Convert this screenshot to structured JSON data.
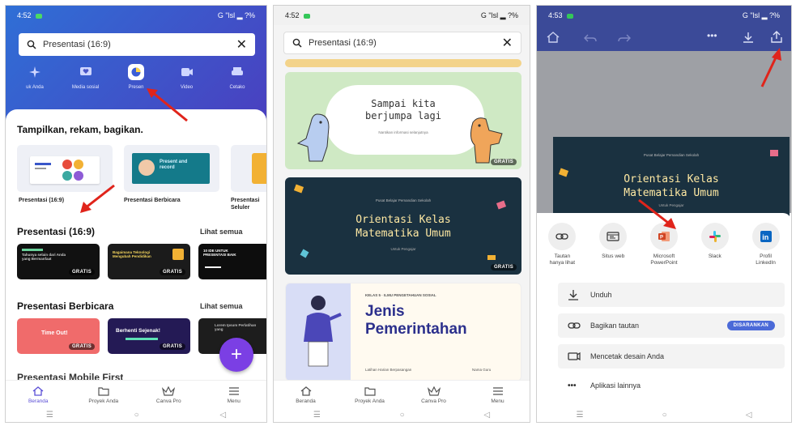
{
  "screen1": {
    "status_time": "4:52",
    "status_right": "G \"lsl ▂ ?% ",
    "search": {
      "query": "Presentasi (16:9)"
    },
    "categories": [
      {
        "label": "uk Anda",
        "icon": "sparkle-icon"
      },
      {
        "label": "Media sosial",
        "icon": "heart-icon"
      },
      {
        "label": "Presen",
        "icon": "presentation-icon"
      },
      {
        "label": "Video",
        "icon": "video-icon"
      },
      {
        "label": "Cetako",
        "icon": "print-icon"
      }
    ],
    "section_title": "Tampilkan, rekam, bagikan.",
    "tiles": [
      {
        "label": "Presentasi (16:9)"
      },
      {
        "label": "Presentasi Berbicara",
        "thumb_text": "Present and record"
      },
      {
        "label": "Presentasi Seluler"
      }
    ],
    "row1": {
      "title": "Presentasi (16:9)",
      "see_all": "Lihat semua",
      "items": [
        {
          "badge": "GRATIS",
          "text": "Tahunya selain dari Anda yang Bermanfaat"
        },
        {
          "badge": "GRATIS",
          "text": "Bagaimana Teknologi Mengubah Pendidikan"
        },
        {
          "badge": "",
          "text": "10 IDE UNTUK PRESENTASI BAIK"
        }
      ]
    },
    "row2": {
      "title": "Presentasi Berbicara",
      "see_all": "Lihat semua",
      "items": [
        {
          "badge": "GRATIS",
          "text": "Time Out!"
        },
        {
          "badge": "GRATIS",
          "text": "Berhenti Sejenak!"
        },
        {
          "badge": "",
          "text": "Lorem Ipsum Perlatihan yang"
        }
      ]
    },
    "row3_title": "Presentasi Mobile First",
    "nav": [
      "Beranda",
      "Proyek Anda",
      "Canva Pro",
      "Menu"
    ]
  },
  "screen2": {
    "status_time": "4:52",
    "status_right": "G \"lsl ▂ ?% ",
    "search": {
      "query": "Presentasi (16:9)"
    },
    "card1": {
      "title_line1": "Sampai kita",
      "title_line2": "berjumpa lagi",
      "subtitle": "Nantikan informasi selanjutnya",
      "badge": "GRATIS"
    },
    "card2": {
      "kicker": "Pusat Belajar Pemandian Sekolah",
      "title_line1": "Orientasi Kelas",
      "title_line2": "Matematika Umum",
      "footer": "Untuk Pengajar",
      "badge": "GRATIS"
    },
    "card3": {
      "kicker": "KELAS 5 · ILMU PENGETAHUAN SOSIAL",
      "title_line1": "Jenis",
      "title_line2": "Pemerintahan",
      "footer_left": "Latihan Harian Berpasangan",
      "footer_right": "Nama Guru"
    },
    "nav": [
      "Beranda",
      "Proyek Anda",
      "Canva Pro",
      "Menu"
    ]
  },
  "screen3": {
    "status_time": "4:53",
    "status_right": "G \"lsl ▂ ?% ",
    "slide": {
      "kicker": "Pusat Belajar Pemandian Sekolah",
      "title_line1": "Orientasi Kelas",
      "title_line2": "Matematika Umum",
      "footer": "Untuk Pengajar"
    },
    "share_targets": [
      {
        "label_line1": "Tautan",
        "label_line2": "hanya lihat",
        "icon": "link-icon"
      },
      {
        "label_line1": "Situs web",
        "label_line2": "",
        "icon": "website-icon"
      },
      {
        "label_line1": "Microsoft",
        "label_line2": "PowerPoint",
        "icon": "powerpoint-icon"
      },
      {
        "label_line1": "Slack",
        "label_line2": "",
        "icon": "slack-icon"
      },
      {
        "label_line1": "Profil",
        "label_line2": "LinkedIn",
        "icon": "linkedin-icon"
      }
    ],
    "options": [
      {
        "label": "Unduh",
        "icon": "download-icon"
      },
      {
        "label": "Bagikan tautan",
        "icon": "link-icon",
        "pill": "DISARANKAN"
      },
      {
        "label": "Mencetak desain Anda",
        "icon": "print-icon"
      },
      {
        "label": "Aplikasi lainnya",
        "icon": "more-icon"
      }
    ]
  },
  "colors": {
    "canva_blue": "#3b4a98",
    "canva_purple": "#7b3fe4",
    "arrow_red": "#e0241b"
  }
}
